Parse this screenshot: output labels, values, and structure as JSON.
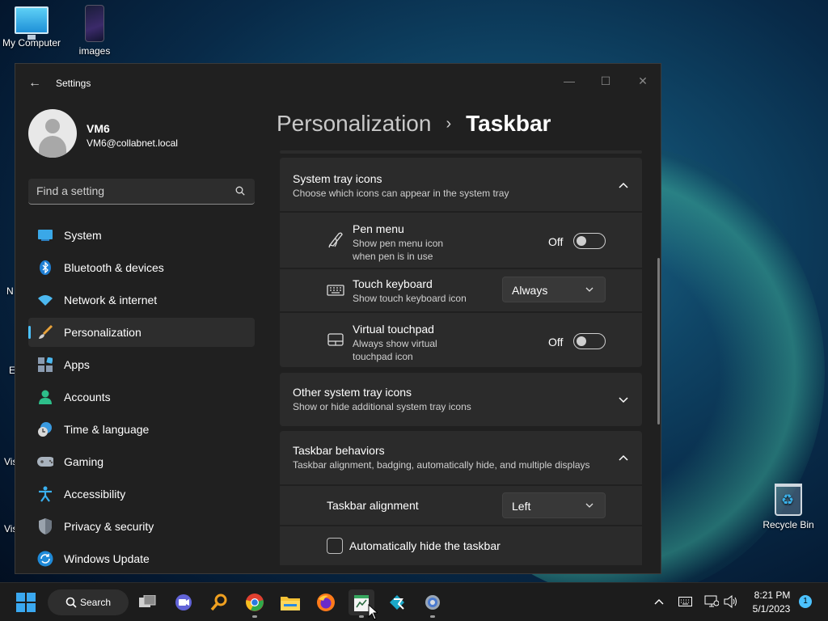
{
  "desktop": {
    "icons": [
      {
        "label": "My Computer"
      },
      {
        "label": "images"
      },
      {
        "label": "Recycle Bin"
      }
    ],
    "edge_letters": [
      "N",
      "E",
      "Vis",
      "Vis"
    ]
  },
  "window": {
    "title": "Settings",
    "back_glyph": "←",
    "controls": {
      "minimize": "—",
      "maximize": "☐",
      "close": "✕"
    }
  },
  "user": {
    "name": "VM6",
    "email": "VM6@collabnet.local"
  },
  "search": {
    "placeholder": "Find a setting"
  },
  "nav": [
    {
      "label": "System",
      "icon": "monitor-icon",
      "active": false
    },
    {
      "label": "Bluetooth & devices",
      "icon": "bluetooth-icon",
      "active": false
    },
    {
      "label": "Network & internet",
      "icon": "wifi-icon",
      "active": false
    },
    {
      "label": "Personalization",
      "icon": "brush-icon",
      "active": true
    },
    {
      "label": "Apps",
      "icon": "apps-icon",
      "active": false
    },
    {
      "label": "Accounts",
      "icon": "person-icon",
      "active": false
    },
    {
      "label": "Time & language",
      "icon": "clock-globe-icon",
      "active": false
    },
    {
      "label": "Gaming",
      "icon": "gamepad-icon",
      "active": false
    },
    {
      "label": "Accessibility",
      "icon": "accessibility-icon",
      "active": false
    },
    {
      "label": "Privacy & security",
      "icon": "shield-icon",
      "active": false
    },
    {
      "label": "Windows Update",
      "icon": "update-icon",
      "active": false
    }
  ],
  "breadcrumb": {
    "parent": "Personalization",
    "separator": "›",
    "current": "Taskbar"
  },
  "sections": {
    "system_tray": {
      "title": "System tray icons",
      "subtitle": "Choose which icons can appear in the system tray",
      "expanded": true,
      "items": {
        "pen": {
          "title": "Pen menu",
          "sub1": "Show pen menu icon",
          "sub2": "when pen is in use",
          "state_label": "Off",
          "icon": "pen-icon"
        },
        "touch_kb": {
          "title": "Touch keyboard",
          "sub1": "Show touch keyboard icon",
          "value": "Always",
          "icon": "keyboard-icon"
        },
        "touchpad": {
          "title": "Virtual touchpad",
          "sub1": "Always show virtual",
          "sub2": "touchpad icon",
          "state_label": "Off",
          "icon": "touchpad-icon"
        }
      }
    },
    "other_tray": {
      "title": "Other system tray icons",
      "subtitle": "Show or hide additional system tray icons",
      "expanded": false
    },
    "behaviors": {
      "title": "Taskbar behaviors",
      "subtitle": "Taskbar alignment, badging, automatically hide, and multiple displays",
      "expanded": true,
      "alignment": {
        "label": "Taskbar alignment",
        "value": "Left"
      },
      "autohide": {
        "label": "Automatically hide the taskbar",
        "checked": false
      }
    }
  },
  "taskbar": {
    "search_label": "Search",
    "apps": [
      "start-icon",
      "task-view-icon",
      "teams-chat-icon",
      "search-tool-icon",
      "chrome-icon",
      "file-explorer-icon",
      "firefox-icon",
      "notepad-icon",
      "app-icon",
      "settings-gear-icon"
    ],
    "clock": {
      "time": "8:21 PM",
      "date": "5/1/2023"
    },
    "notification_count": "1"
  },
  "colors": {
    "accent": "#4cc2ff",
    "window_bg": "#202020",
    "card_bg": "#2b2b2b",
    "taskbar_bg": "#1c1c1c"
  }
}
